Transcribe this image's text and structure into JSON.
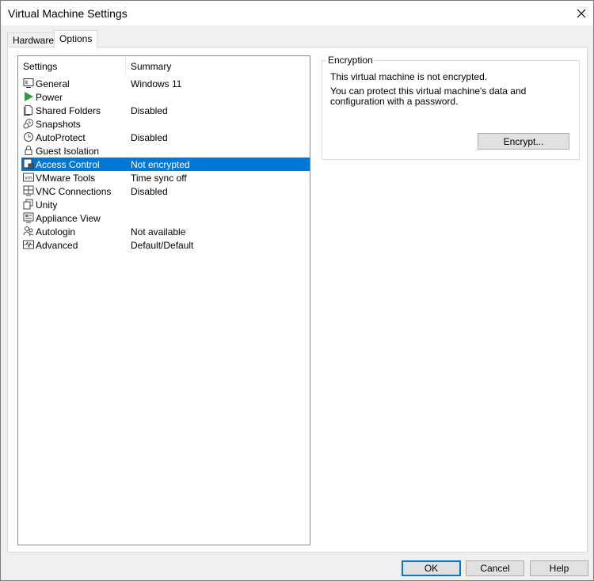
{
  "window": {
    "title": "Virtual Machine Settings"
  },
  "tabs": [
    {
      "label": "Hardware"
    },
    {
      "label": "Options"
    }
  ],
  "settings_list": {
    "headers": {
      "settings": "Settings",
      "summary": "Summary"
    },
    "items": [
      {
        "label": "General",
        "summary": "Windows 11",
        "icon": "monitor-icon"
      },
      {
        "label": "Power",
        "summary": "",
        "icon": "play-icon"
      },
      {
        "label": "Shared Folders",
        "summary": "Disabled",
        "icon": "document-icon"
      },
      {
        "label": "Snapshots",
        "summary": "",
        "icon": "snapshot-clock-icon"
      },
      {
        "label": "AutoProtect",
        "summary": "Disabled",
        "icon": "clock-icon"
      },
      {
        "label": "Guest Isolation",
        "summary": "",
        "icon": "lock-icon"
      },
      {
        "label": "Access Control",
        "summary": "Not encrypted",
        "icon": "access-control-icon",
        "selected": true
      },
      {
        "label": "VMware Tools",
        "summary": "Time sync off",
        "icon": "vm-icon"
      },
      {
        "label": "VNC Connections",
        "summary": "Disabled",
        "icon": "vnc-grid-icon"
      },
      {
        "label": "Unity",
        "summary": "",
        "icon": "unity-windows-icon"
      },
      {
        "label": "Appliance View",
        "summary": "",
        "icon": "appliance-view-icon"
      },
      {
        "label": "Autologin",
        "summary": "Not available",
        "icon": "users-icon"
      },
      {
        "label": "Advanced",
        "summary": "Default/Default",
        "icon": "waveform-icon"
      }
    ]
  },
  "encryption": {
    "title": "Encryption",
    "status": "This virtual machine is not encrypted.",
    "description": "You can protect this virtual machine's data and configuration with a password.",
    "encrypt_button": "Encrypt..."
  },
  "footer": {
    "ok": "OK",
    "cancel": "Cancel",
    "help": "Help"
  },
  "colors": {
    "selection": "#0078d7",
    "power_icon": "#2ea043"
  }
}
